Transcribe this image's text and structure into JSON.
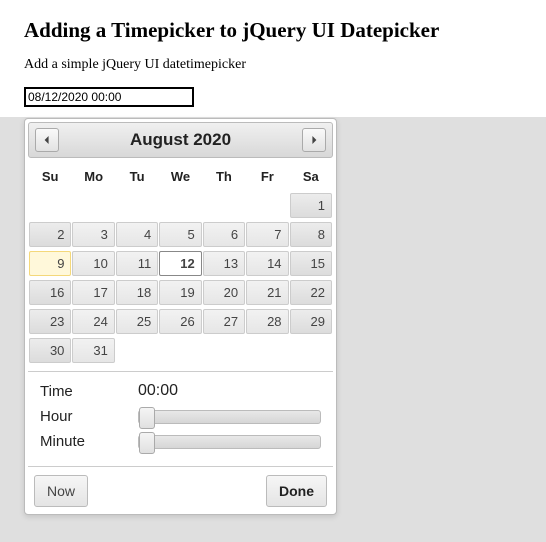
{
  "heading": "Adding a Timepicker to jQuery UI Datepicker",
  "subtitle": "Add a simple jQuery UI datetimepicker",
  "input_value": "08/12/2020 00:00",
  "calendar": {
    "title": "August 2020",
    "dow": [
      "Su",
      "Mo",
      "Tu",
      "We",
      "Th",
      "Fr",
      "Sa"
    ],
    "weeks": [
      [
        null,
        null,
        null,
        null,
        null,
        null,
        {
          "n": 1,
          "wknd": true
        }
      ],
      [
        {
          "n": 2,
          "wknd": true
        },
        {
          "n": 3
        },
        {
          "n": 4
        },
        {
          "n": 5
        },
        {
          "n": 6
        },
        {
          "n": 7
        },
        {
          "n": 8,
          "wknd": true
        }
      ],
      [
        {
          "n": 9,
          "wknd": true,
          "today": true
        },
        {
          "n": 10
        },
        {
          "n": 11
        },
        {
          "n": 12,
          "sel": true
        },
        {
          "n": 13
        },
        {
          "n": 14
        },
        {
          "n": 15,
          "wknd": true
        }
      ],
      [
        {
          "n": 16,
          "wknd": true
        },
        {
          "n": 17
        },
        {
          "n": 18
        },
        {
          "n": 19
        },
        {
          "n": 20
        },
        {
          "n": 21
        },
        {
          "n": 22,
          "wknd": true
        }
      ],
      [
        {
          "n": 23,
          "wknd": true
        },
        {
          "n": 24
        },
        {
          "n": 25
        },
        {
          "n": 26
        },
        {
          "n": 27
        },
        {
          "n": 28
        },
        {
          "n": 29,
          "wknd": true
        }
      ],
      [
        {
          "n": 30,
          "wknd": true
        },
        {
          "n": 31
        },
        null,
        null,
        null,
        null,
        null
      ]
    ]
  },
  "time": {
    "label": "Time",
    "value": "00:00",
    "hour_label": "Hour",
    "minute_label": "Minute"
  },
  "buttons": {
    "now": "Now",
    "done": "Done"
  }
}
